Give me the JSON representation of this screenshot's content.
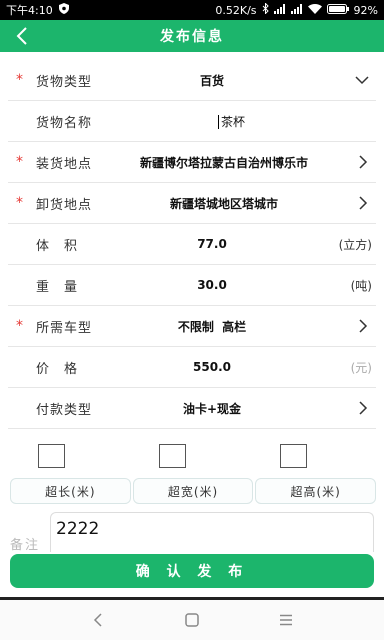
{
  "status_bar": {
    "time": "下午4:10",
    "speed": "0.52K/s",
    "battery": "92%",
    "icons": [
      "shield-icon",
      "bluetooth-icon",
      "signal-icon",
      "signal-icon",
      "wifi-icon",
      "battery-icon"
    ]
  },
  "header": {
    "title": "发布信息",
    "back_icon": "chevron-left-icon"
  },
  "form": {
    "goods_type": {
      "label": "货物类型",
      "required": "*",
      "value": "百货",
      "icon": "chevron-down-icon"
    },
    "goods_name": {
      "label": "货物名称",
      "value": "茶杯"
    },
    "load_place": {
      "label": "装货地点",
      "required": "*",
      "value": "新疆博尔塔拉蒙古自治州博乐市",
      "icon": "chevron-right-icon"
    },
    "unload_place": {
      "label": "卸货地点",
      "required": "*",
      "value": "新疆塔城地区塔城市",
      "icon": "chevron-right-icon"
    },
    "volume": {
      "label": "体　积",
      "value": "77.0",
      "unit": "(立方)"
    },
    "weight": {
      "label": "重　量",
      "value": "30.0",
      "unit": "(吨)"
    },
    "vehicle": {
      "label": "所需车型",
      "required": "*",
      "value": "不限制  高栏",
      "icon": "chevron-right-icon"
    },
    "price": {
      "label": "价　格",
      "value": "550.0",
      "unit": "(元)"
    },
    "payment": {
      "label": "付款类型",
      "value": "油卡+现金",
      "icon": "chevron-right-icon"
    }
  },
  "oversize": {
    "long": "超长(米)",
    "wide": "超宽(米)",
    "high": "超高(米)"
  },
  "remark": {
    "label": "备注",
    "value": "2222"
  },
  "submit_label": "确 认 发 布",
  "nav": [
    "back-nav-icon",
    "home-nav-icon",
    "menu-nav-icon"
  ],
  "colors": {
    "accent": "#1cb56c",
    "required": "#e53935"
  }
}
